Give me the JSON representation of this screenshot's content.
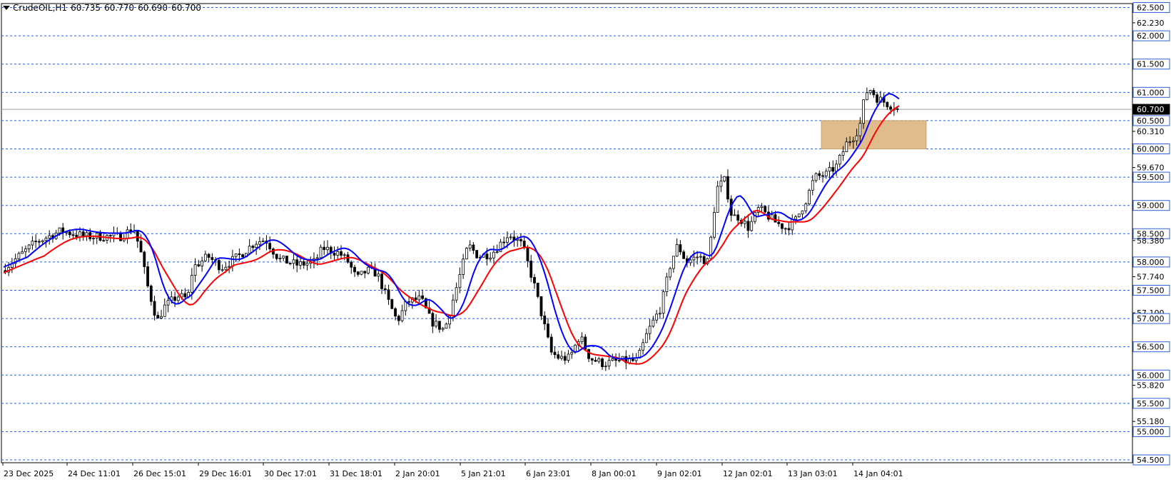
{
  "header": {
    "symbol": "CrudeOIL,H1",
    "open": "60.735",
    "high": "60.770",
    "low": "60.690",
    "close": "60.700"
  },
  "chart_data": {
    "type": "candlestick",
    "symbol": "CrudeOIL",
    "timeframe": "H1",
    "ylim": [
      54.45,
      62.57
    ],
    "level_lines": [
      62.5,
      62.0,
      61.5,
      61.0,
      60.5,
      60.0,
      59.5,
      59.0,
      58.5,
      58.0,
      57.5,
      57.0,
      56.5,
      56.0,
      55.5,
      55.0,
      54.5
    ],
    "price_labels": [
      {
        "value": 62.5,
        "text": "62.500",
        "boxed": true
      },
      {
        "value": 62.23,
        "text": "62.230",
        "boxed": false
      },
      {
        "value": 62.0,
        "text": "62.000",
        "boxed": true
      },
      {
        "value": 61.5,
        "text": "61.500",
        "boxed": true
      },
      {
        "value": 61.0,
        "text": "61.000",
        "boxed": true
      },
      {
        "value": 60.7,
        "text": "60.700",
        "boxed": true,
        "current": true
      },
      {
        "value": 60.5,
        "text": "60.500",
        "boxed": true
      },
      {
        "value": 60.31,
        "text": "60.310",
        "boxed": false
      },
      {
        "value": 60.0,
        "text": "60.000",
        "boxed": true
      },
      {
        "value": 59.67,
        "text": "59.670",
        "boxed": false
      },
      {
        "value": 59.5,
        "text": "59.500",
        "boxed": true
      },
      {
        "value": 59.0,
        "text": "59.000",
        "boxed": true
      },
      {
        "value": 58.5,
        "text": "58.500",
        "boxed": true
      },
      {
        "value": 58.38,
        "text": "58.380",
        "boxed": false
      },
      {
        "value": 58.0,
        "text": "58.000",
        "boxed": true
      },
      {
        "value": 57.74,
        "text": "57.740",
        "boxed": false
      },
      {
        "value": 57.5,
        "text": "57.500",
        "boxed": true
      },
      {
        "value": 57.1,
        "text": "57.100",
        "boxed": false
      },
      {
        "value": 57.0,
        "text": "57.000",
        "boxed": true
      },
      {
        "value": 56.5,
        "text": "56.500",
        "boxed": true
      },
      {
        "value": 56.0,
        "text": "56.000",
        "boxed": true
      },
      {
        "value": 55.82,
        "text": "55.820",
        "boxed": false
      },
      {
        "value": 55.5,
        "text": "55.500",
        "boxed": true
      },
      {
        "value": 55.18,
        "text": "55.180",
        "boxed": false
      },
      {
        "value": 55.0,
        "text": "55.000",
        "boxed": true
      },
      {
        "value": 54.5,
        "text": "54.500",
        "boxed": true
      }
    ],
    "current_price": 60.7,
    "x_labels": [
      "23 Dec 2025",
      "24 Dec 11:01",
      "26 Dec 15:01",
      "29 Dec 16:01",
      "30 Dec 17:01",
      "31 Dec 18:01",
      "2 Jan 20:01",
      "5 Jan 21:01",
      "6 Jan 23:01",
      "8 Jan 00:01",
      "9 Jan 02:01",
      "12 Jan 02:01",
      "13 Jan 03:01",
      "14 Jan 04:01"
    ],
    "bar_count": 264,
    "zone": {
      "low": 60.0,
      "high": 60.5,
      "from_bar": 242,
      "to_bar": 273,
      "color": "#deb887"
    },
    "price_path": [
      [
        0,
        57.85
      ],
      [
        10,
        58.1
      ],
      [
        20,
        58.35
      ],
      [
        35,
        58.55
      ],
      [
        50,
        58.45
      ],
      [
        70,
        58.45
      ],
      [
        78,
        58.6
      ],
      [
        82,
        58.2
      ],
      [
        86,
        57.6
      ],
      [
        92,
        56.95
      ],
      [
        96,
        57.2
      ],
      [
        104,
        57.4
      ],
      [
        110,
        57.35
      ],
      [
        113,
        57.9
      ],
      [
        122,
        58.1
      ],
      [
        130,
        57.9
      ],
      [
        140,
        58.1
      ],
      [
        150,
        58.35
      ],
      [
        156,
        58.4
      ],
      [
        164,
        58.05
      ],
      [
        175,
        57.95
      ],
      [
        185,
        58.0
      ],
      [
        190,
        58.25
      ],
      [
        200,
        58.15
      ],
      [
        205,
        58.0
      ],
      [
        210,
        57.7
      ],
      [
        216,
        57.85
      ],
      [
        222,
        57.8
      ],
      [
        228,
        57.35
      ],
      [
        234,
        56.95
      ],
      [
        240,
        57.3
      ],
      [
        248,
        57.35
      ],
      [
        254,
        56.95
      ],
      [
        262,
        56.8
      ],
      [
        270,
        57.65
      ],
      [
        276,
        58.3
      ],
      [
        282,
        58.1
      ],
      [
        290,
        58.15
      ],
      [
        300,
        58.5
      ],
      [
        308,
        58.3
      ],
      [
        315,
        57.6
      ],
      [
        320,
        57.0
      ],
      [
        325,
        56.4
      ],
      [
        330,
        56.3
      ],
      [
        336,
        56.3
      ],
      [
        342,
        56.7
      ],
      [
        348,
        56.3
      ],
      [
        356,
        56.2
      ],
      [
        365,
        56.25
      ],
      [
        372,
        56.25
      ],
      [
        376,
        56.25
      ],
      [
        382,
        56.75
      ],
      [
        390,
        57.2
      ],
      [
        396,
        58.0
      ],
      [
        400,
        58.3
      ],
      [
        405,
        58.0
      ],
      [
        412,
        58.1
      ],
      [
        418,
        58.0
      ],
      [
        423,
        59.3
      ],
      [
        428,
        59.45
      ],
      [
        432,
        58.8
      ],
      [
        436,
        58.8
      ],
      [
        442,
        58.6
      ],
      [
        448,
        58.95
      ],
      [
        452,
        58.85
      ],
      [
        458,
        58.7
      ],
      [
        464,
        58.6
      ],
      [
        470,
        58.75
      ],
      [
        476,
        59.1
      ],
      [
        481,
        59.5
      ],
      [
        488,
        59.55
      ],
      [
        494,
        59.7
      ],
      [
        500,
        60.1
      ],
      [
        505,
        60.25
      ],
      [
        508,
        60.45
      ],
      [
        511,
        61.0
      ],
      [
        514,
        61.05
      ],
      [
        518,
        60.9
      ],
      [
        524,
        60.8
      ],
      [
        528,
        60.75
      ],
      [
        530,
        60.7
      ]
    ],
    "series": [
      {
        "type": "moving-average",
        "color": "#0000ff",
        "from": [
          0,
          57.8
        ],
        "to": [
          530,
          60.6
        ]
      },
      {
        "type": "moving-average",
        "color": "#ff0000",
        "from": [
          0,
          57.65
        ],
        "to": [
          530,
          60.4
        ]
      }
    ]
  },
  "colors": {
    "background": "#ffffff",
    "grid": "#2e5fdb",
    "candle_bull": "#ffffff",
    "candle_bear": "#000000",
    "candle_outline": "#000000",
    "ma_fast": "#0000ff",
    "ma_slow": "#ff0000",
    "zone": "#deb887",
    "current_price_label_bg": "#000000"
  }
}
